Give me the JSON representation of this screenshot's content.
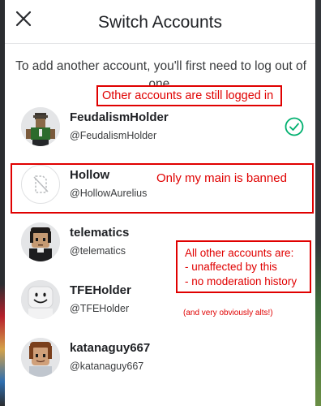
{
  "modal": {
    "title": "Switch Accounts",
    "instructions": "To add another account, you'll first need to log out of one."
  },
  "accounts": [
    {
      "username": "FeudalismHolder",
      "handle": "@FeudalismHolder",
      "active": true
    },
    {
      "username": "Hollow",
      "handle": "@HollowAurelius",
      "active": false
    },
    {
      "username": "telematics",
      "handle": "@telematics",
      "active": false
    },
    {
      "username": "TFEHolder",
      "handle": "@TFEHolder",
      "active": false
    },
    {
      "username": "katanaguy667",
      "handle": "@katanaguy667",
      "active": false
    }
  ],
  "annotations": {
    "logged_in": "Other accounts are still logged in",
    "banned": "Only my main is banned",
    "unaffected": [
      "All other accounts are:",
      "- unaffected by this",
      "- no moderation history"
    ],
    "alts": "(and very obviously alts!)"
  },
  "colors": {
    "annotation": "#e00000",
    "check": "#00b06f"
  },
  "icons": {
    "close": "close-icon",
    "check": "checkmark-circle-icon",
    "placeholder": "placeholder-avatar-icon"
  }
}
